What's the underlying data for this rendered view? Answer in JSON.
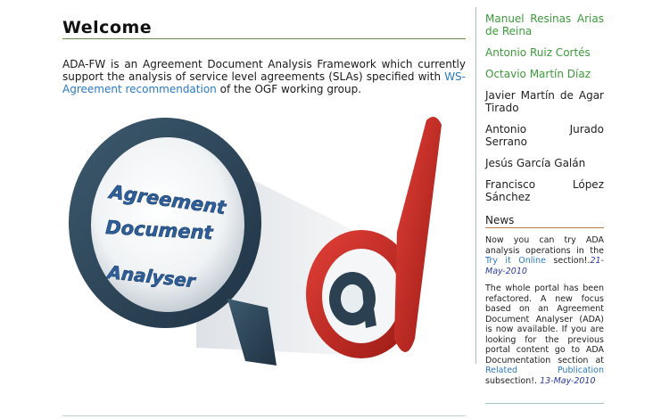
{
  "welcome": {
    "title": "Welcome",
    "intro_before": "ADA-FW is an Agreement Document Analysis Framework which currently support the analysis of service level agreements (SLAs) specified with ",
    "intro_link": "WS-Agreement recommendation",
    "intro_after": " of the OGF working group."
  },
  "logo": {
    "line1": "Agreement",
    "line2": "Document",
    "line3": "Analyser"
  },
  "people": [
    {
      "name": "Manuel Resinas Arias de Reina",
      "color": "#3c9a3a"
    },
    {
      "name": "Antonio Ruiz Cortés",
      "color": "#3c9a3a"
    },
    {
      "name": "Octavio Martín Díaz",
      "color": "#3c9a3a"
    },
    {
      "name": "Javier Martín de Agar Tirado",
      "color": "#222222"
    },
    {
      "name": "Antonio Jurado Serrano",
      "color": "#222222"
    },
    {
      "name": "Jesús García Galán",
      "color": "#222222"
    },
    {
      "name": "Francisco López Sánchez",
      "color": "#222222"
    }
  ],
  "news": {
    "title": "News",
    "item1": {
      "text_before": "Now you can try ADA analysis operations in the ",
      "link": "Try it Online",
      "text_after": " section!.",
      "date": "21-May-2010"
    },
    "item2": {
      "text_before": "The whole portal has been refactored. A new focus based on an Agreement Document Analyser (ADA) is now available. If you are looking for the previous portal content go to ADA Documentation section at ",
      "link": "Related Publication",
      "text_after": " subsection!. ",
      "date": "13-May-2010"
    }
  }
}
